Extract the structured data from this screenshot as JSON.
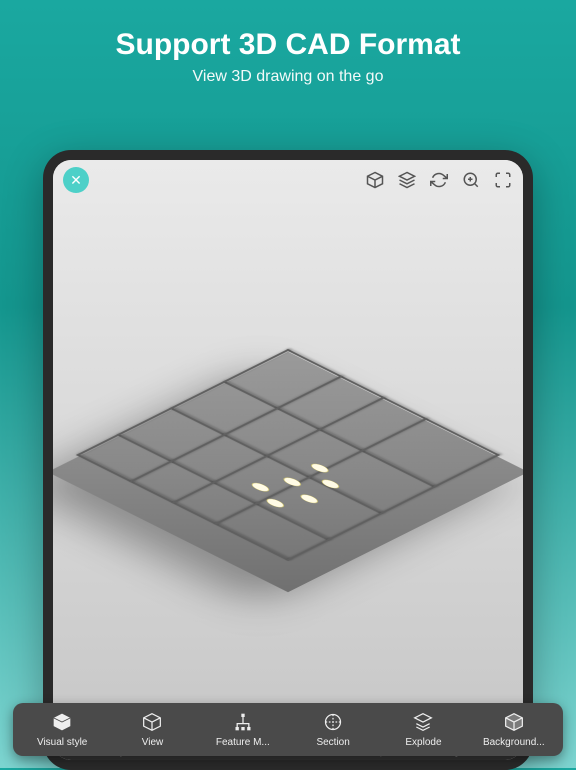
{
  "header": {
    "title": "Support 3D CAD Format",
    "subtitle": "View 3D drawing on the go"
  },
  "topbar": {
    "close": "✕",
    "icons": {
      "cube": "cube-icon",
      "layers": "layers-icon",
      "refresh": "refresh-icon",
      "zoom": "zoom-icon",
      "fullscreen": "fullscreen-icon"
    }
  },
  "toolbar": {
    "items": [
      {
        "label": "Visual style",
        "icon": "cube-solid-icon"
      },
      {
        "label": "View",
        "icon": "cube-wire-icon"
      },
      {
        "label": "Feature M...",
        "icon": "tree-icon"
      },
      {
        "label": "Section",
        "icon": "section-icon"
      },
      {
        "label": "Explode",
        "icon": "explode-icon"
      },
      {
        "label": "Background...",
        "icon": "background-icon"
      }
    ]
  }
}
